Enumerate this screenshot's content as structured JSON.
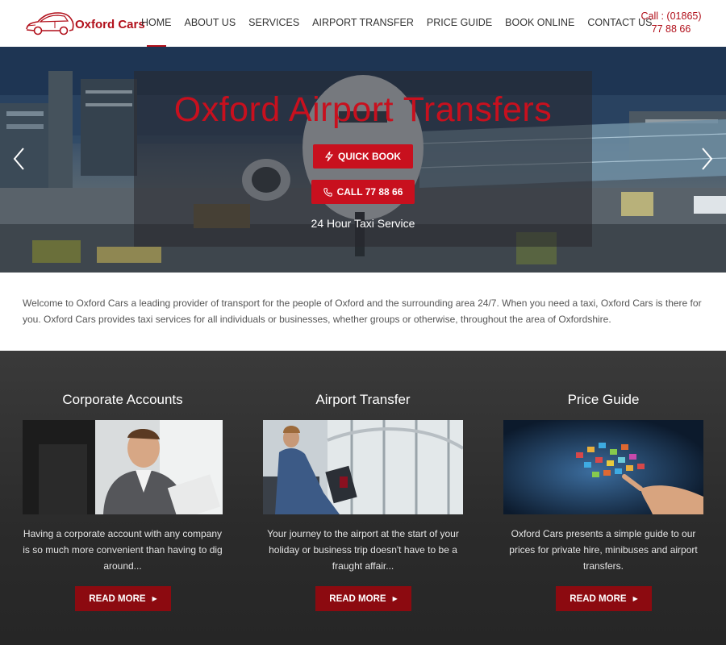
{
  "brand": {
    "name": "Oxford Cars",
    "color": "#b10f1a"
  },
  "nav": {
    "items": [
      {
        "label": "HOME",
        "active": true
      },
      {
        "label": "ABOUT US"
      },
      {
        "label": "SERVICES"
      },
      {
        "label": "AIRPORT TRANSFER"
      },
      {
        "label": "PRICE GUIDE"
      },
      {
        "label": "BOOK ONLINE"
      },
      {
        "label": "CONTACT US"
      }
    ],
    "call_line1": "Call : (01865)",
    "call_line2": "77 88 66"
  },
  "hero": {
    "title": "Oxford Airport Transfers",
    "quick_book_label": "QUICK BOOK",
    "quick_book_icon": "lightning-icon",
    "call_label": "CALL 77 88 66",
    "call_icon": "phone-icon",
    "subtitle": "24 Hour Taxi Service",
    "prev_icon": "chevron-left-icon",
    "next_icon": "chevron-right-icon"
  },
  "intro": {
    "text": "Welcome to Oxford Cars a leading provider of transport for the people of Oxford and the surrounding area 24/7. When you need a taxi, Oxford Cars is there for you. Oxford Cars provides taxi services for all individuals or businesses, whether groups or otherwise, throughout the area of Oxfordshire."
  },
  "services": [
    {
      "title": "Corporate Accounts",
      "text": "Having a corporate account with any company is so much more convenient than having to dig around...",
      "button": "READ MORE"
    },
    {
      "title": "Airport Transfer",
      "text": "Your journey to the airport at the start of your holiday or business trip doesn't have to be a fraught affair...",
      "button": "READ MORE"
    },
    {
      "title": "Price Guide",
      "text": "Oxford Cars presents a simple guide to our prices for private hire, minibuses and airport transfers.",
      "button": "READ MORE"
    }
  ]
}
